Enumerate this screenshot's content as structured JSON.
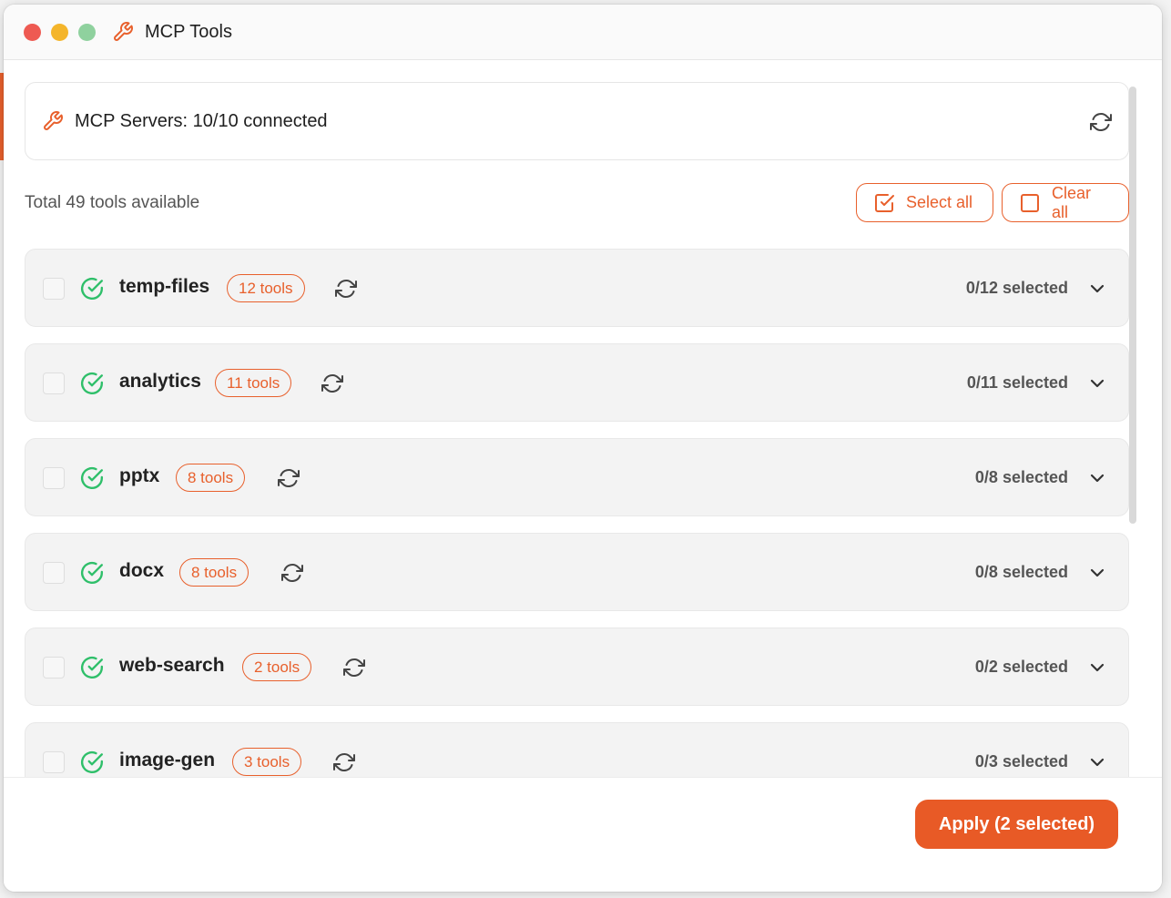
{
  "window": {
    "title": "MCP Tools"
  },
  "status": {
    "text": "MCP Servers: 10/10 connected"
  },
  "toolbar": {
    "total_text": "Total 49 tools available",
    "select_all_label": "Select all",
    "clear_all_label": "Clear all"
  },
  "servers": [
    {
      "name": "temp-files",
      "badge": "12 tools",
      "selected": "0/12 selected"
    },
    {
      "name": "analytics",
      "badge": "11 tools",
      "selected": "0/11 selected"
    },
    {
      "name": "pptx",
      "badge": "8 tools",
      "selected": "0/8 selected"
    },
    {
      "name": "docx",
      "badge": "8 tools",
      "selected": "0/8 selected"
    },
    {
      "name": "web-search",
      "badge": "2 tools",
      "selected": "0/2 selected"
    },
    {
      "name": "image-gen",
      "badge": "3 tools",
      "selected": "0/3 selected"
    }
  ],
  "footer": {
    "apply_label": "Apply (2 selected)"
  },
  "colors": {
    "accent": "#e8602c",
    "success": "#2fbf6a",
    "close": "#ee5a52",
    "minimize": "#f4b52b",
    "zoom": "#8fd19e"
  },
  "icons": {
    "title": "wrench-icon",
    "status": "wrench-icon",
    "refresh": "refresh-icon",
    "select_all": "checkbox-checked-icon",
    "clear_all": "checkbox-empty-icon",
    "server_status": "check-circle-icon",
    "expand": "chevron-down-icon"
  }
}
